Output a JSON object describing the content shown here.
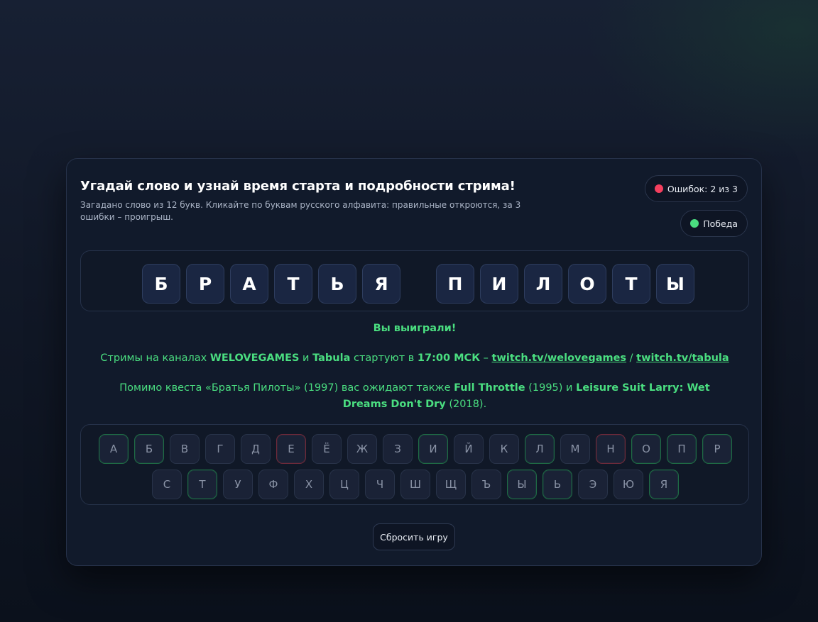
{
  "header": {
    "title": "Угадай слово и узнай время старта и подробности стрима!",
    "subtitle": "Загадано слово из 12 букв. Кликайте по буквам русского алфавита: правильные откроются, за 3 ошибки – проигрыш."
  },
  "errors": {
    "label": "Ошибок:",
    "value": "2 из 3",
    "color": "#f43f5e"
  },
  "status": {
    "label": "Победа",
    "color": "#4ade80"
  },
  "word": {
    "first": [
      "Б",
      "Р",
      "А",
      "Т",
      "Ь",
      "Я"
    ],
    "second": [
      "П",
      "И",
      "Л",
      "О",
      "Т",
      "Ы"
    ]
  },
  "messages": {
    "win": "Вы выиграли!",
    "streams": {
      "prefix": "Стримы на каналах ",
      "channel1": "WELOVEGAMES",
      "and": " и ",
      "channel2": "Tabula",
      "middle": " стартуют в ",
      "time": "17:00 МСК",
      "dash": " – ",
      "link1": "twitch.tv/welovegames",
      "slash": " / ",
      "link2": "twitch.tv/tabula"
    },
    "more": {
      "prefix": "Помимо квеста «Братья Пилоты» (1997) вас ожидают также ",
      "game1": "Full Throttle",
      "year1": " (1995) и ",
      "game2": "Leisure Suit Larry: Wet Dreams Don't Dry",
      "year2": " (2018)."
    }
  },
  "keyboard": {
    "row1": [
      {
        "l": "А",
        "s": "correct"
      },
      {
        "l": "Б",
        "s": "correct"
      },
      {
        "l": "В",
        "s": ""
      },
      {
        "l": "Г",
        "s": ""
      },
      {
        "l": "Д",
        "s": ""
      },
      {
        "l": "Е",
        "s": "wrong"
      },
      {
        "l": "Ё",
        "s": ""
      },
      {
        "l": "Ж",
        "s": ""
      },
      {
        "l": "З",
        "s": ""
      },
      {
        "l": "И",
        "s": "correct"
      },
      {
        "l": "Й",
        "s": ""
      },
      {
        "l": "К",
        "s": ""
      },
      {
        "l": "Л",
        "s": "correct"
      },
      {
        "l": "М",
        "s": ""
      },
      {
        "l": "Н",
        "s": "wrong"
      },
      {
        "l": "О",
        "s": "correct"
      },
      {
        "l": "П",
        "s": "correct"
      },
      {
        "l": "Р",
        "s": "correct"
      }
    ],
    "row2": [
      {
        "l": "С",
        "s": ""
      },
      {
        "l": "Т",
        "s": "correct"
      },
      {
        "l": "У",
        "s": ""
      },
      {
        "l": "Ф",
        "s": ""
      },
      {
        "l": "Х",
        "s": ""
      },
      {
        "l": "Ц",
        "s": ""
      },
      {
        "l": "Ч",
        "s": ""
      },
      {
        "l": "Ш",
        "s": ""
      },
      {
        "l": "Щ",
        "s": ""
      },
      {
        "l": "Ъ",
        "s": ""
      },
      {
        "l": "Ы",
        "s": "correct"
      },
      {
        "l": "Ь",
        "s": "correct"
      },
      {
        "l": "Э",
        "s": ""
      },
      {
        "l": "Ю",
        "s": ""
      },
      {
        "l": "Я",
        "s": "correct"
      }
    ]
  },
  "reset_label": "Сбросить игру"
}
